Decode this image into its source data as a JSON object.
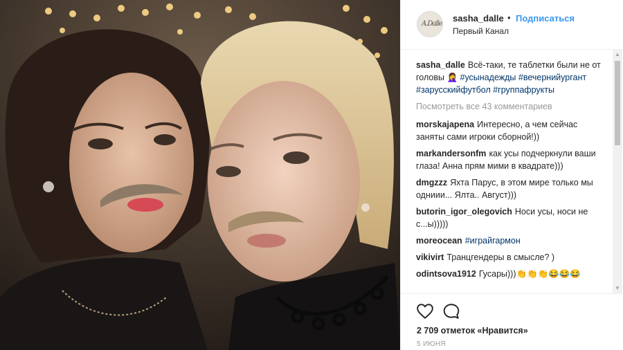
{
  "header": {
    "username": "sasha_dalle",
    "separator": "•",
    "follow_label": "Подписаться",
    "location": "Первый Канал",
    "avatar_text": "A.Dalle"
  },
  "caption": {
    "username": "sasha_dalle",
    "text": "Всё-таки, те таблетки были не от головы 🤦‍♀️",
    "tags": [
      "#усынадежды",
      "#вечернийургант",
      "#зарусскийфутбол",
      "#группафрукты"
    ]
  },
  "view_all_comments": "Посмотреть все 43 комментариев",
  "comments": [
    {
      "username": "morskajapena",
      "text": "Интересно, а чем сейчас заняты сами игроки сборной!))"
    },
    {
      "username": "markandersonfm",
      "text": "как усы подчеркнули ваши глаза! Анна прям мими в квадрате)))"
    },
    {
      "username": "dmgzzz",
      "text": "Яхта Парус, в этом мире только мы одниии... Ялта.. Август)))"
    },
    {
      "username": "butorin_igor_olegovich",
      "text": "Носи усы, носи не с...ы)))))"
    },
    {
      "username": "moreocean",
      "text": "#играйгармон"
    },
    {
      "username": "vikivirt",
      "text": "Транцгендеры в смысле? )"
    },
    {
      "username": "odintsova1912",
      "text": "Гусары)))👏👏👏😂😂😂"
    }
  ],
  "likes_text": "2 709 отметок «Нравится»",
  "date_text": "5 июня",
  "icons": {
    "like": "heart-outline-icon",
    "comment": "speech-bubble-icon",
    "scroll_up": "triangle-up-icon",
    "scroll_down": "triangle-down-icon"
  },
  "colors": {
    "link": "#3897f0",
    "hashtag": "#003569",
    "muted": "#999999",
    "text": "#262626"
  }
}
